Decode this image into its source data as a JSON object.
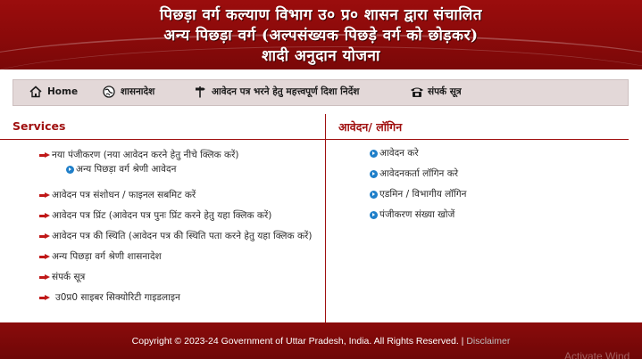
{
  "header": {
    "line1": "पिछड़ा  वर्ग कल्याण विभाग उ० प्र० शासन द्वारा संचालित",
    "line2": "अन्य पिछड़ा वर्ग (अल्पसंख्यक पिछड़े वर्ग को छोड़कर)",
    "line3": "शादी अनुदान योजना"
  },
  "nav": {
    "items": [
      {
        "label": "Home",
        "icon": "home-icon"
      },
      {
        "label": "शासनादेश",
        "icon": "globe-icon"
      },
      {
        "label": "आवेदन पत्र भरने हेतु महत्त्वपूर्ण दिशा निर्देश",
        "icon": "signpost-icon"
      },
      {
        "label": "संपर्क सूत्र",
        "icon": "telephone-icon"
      }
    ]
  },
  "services": {
    "title": "Services",
    "items": [
      "नया पंजीकरण (नया आवेदन करने हेतु नीचे क्लिक करें)",
      "अन्य पिछड़ा वर्ग श्रेणी आवेदन",
      "आवेदन पत्र संशोधन / फाइनल सबमिट करें",
      "आवेदन पत्र प्रिंट (आवेदन पत्र पुनः प्रिंट करने हेतु यहा क्लिक करें)",
      "आवेदन पत्र की स्थिति (आवेदन पत्र की स्थिति पता करने हेतु यहा क्लिक करें)",
      "अन्य पिछड़ा वर्ग श्रेणी शासनादेश",
      "संपर्क सूत्र",
      "उ0प्र0 साइबर सिक्योरिटी गाइडलाइन"
    ]
  },
  "login": {
    "title": "आवेदन/ लॉगिन",
    "items": [
      "आवेदन करे",
      "आवेदनकर्ता लॉगिन करे",
      "एडमिन / विभागीय लॉगिन",
      "पंजीकरण संख्या खोजें"
    ]
  },
  "footer": {
    "copyright": "Copyright © 2023-24 Government of Uttar Pradesh, India. All Rights Reserved. |",
    "disclaimer": "Disclaimer"
  },
  "watermark": "Activate Wind",
  "colors": {
    "header_bg": "#8a0a0a",
    "accent_red": "#a01010",
    "nav_bg": "#e3d8d8",
    "bullet_blue": "#1f7fc9"
  }
}
